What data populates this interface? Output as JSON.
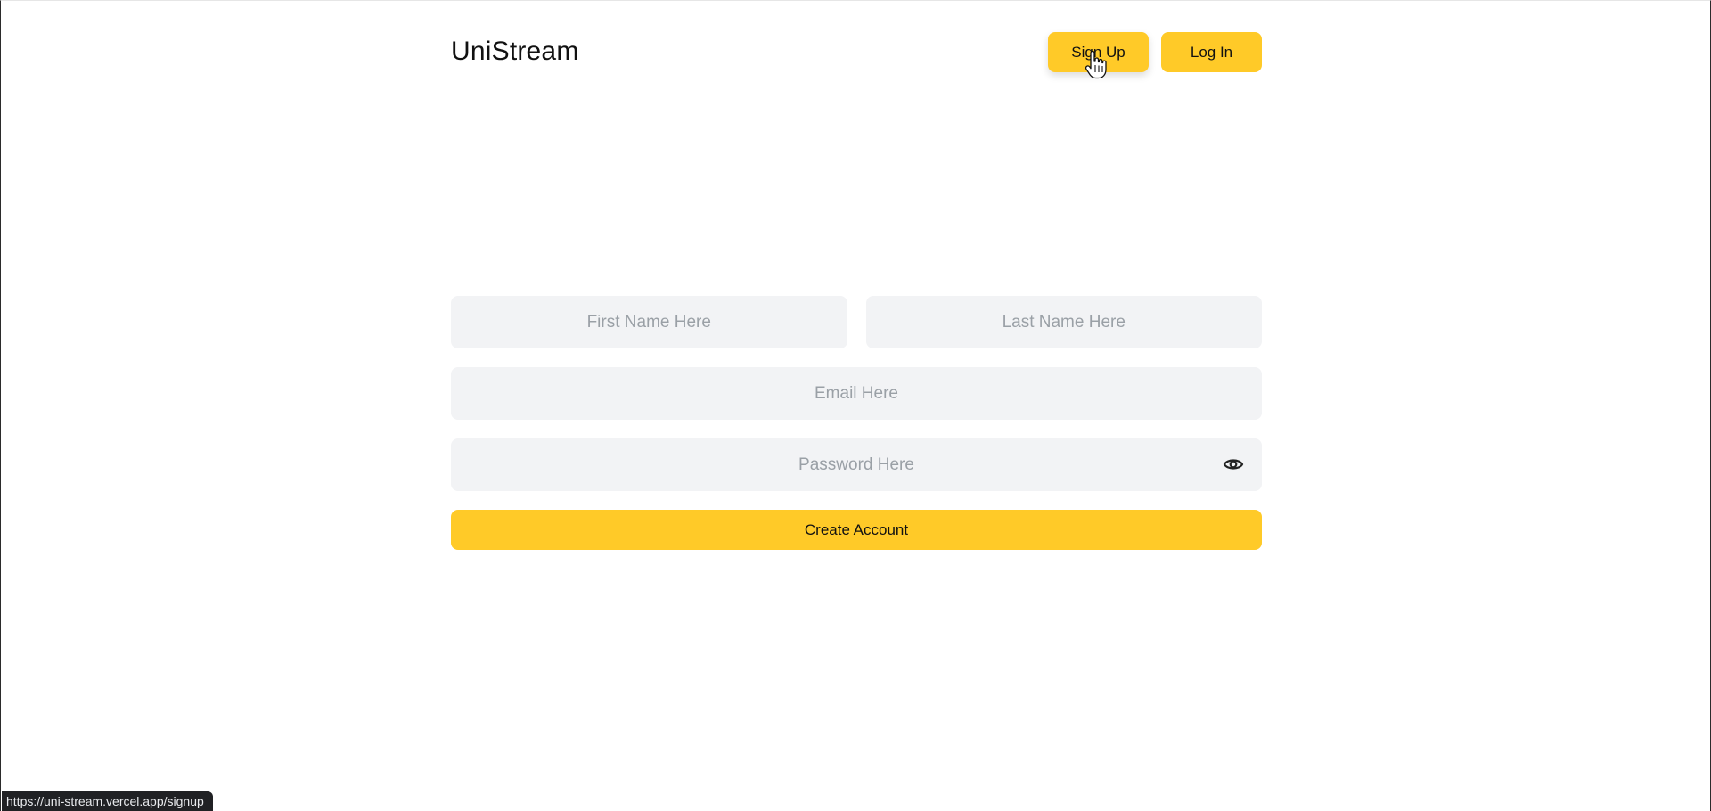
{
  "header": {
    "brand": "UniStream",
    "signup_label": "Sign Up",
    "login_label": "Log In"
  },
  "form": {
    "first_name": {
      "placeholder": "First Name Here",
      "value": ""
    },
    "last_name": {
      "placeholder": "Last Name Here",
      "value": ""
    },
    "email": {
      "placeholder": "Email Here",
      "value": ""
    },
    "password": {
      "placeholder": "Password Here",
      "value": ""
    },
    "submit_label": "Create Account",
    "password_toggle_icon": "eye-icon"
  },
  "status_bar": {
    "url": "https://uni-stream.vercel.app/signup"
  },
  "colors": {
    "accent": "#ffca28",
    "field_bg": "#f2f3f5",
    "placeholder": "#9aa0a6"
  },
  "cursor": {
    "icon": "hand-pointer-icon"
  }
}
